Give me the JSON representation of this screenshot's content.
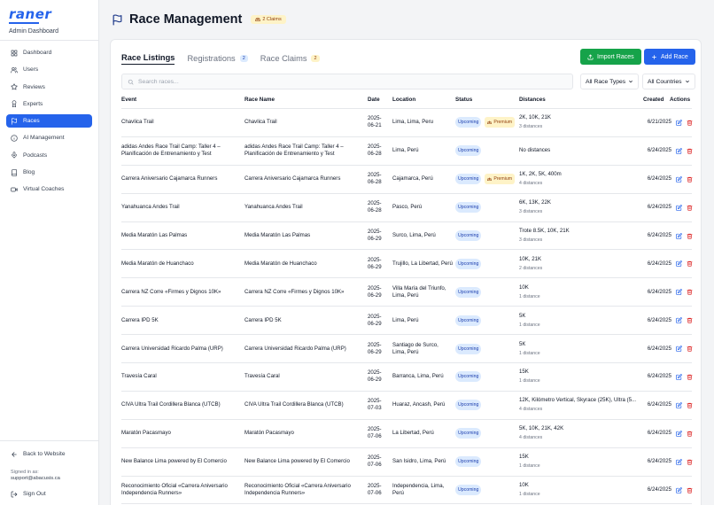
{
  "brand": {
    "logo": "raner",
    "subtitle": "Admin Dashboard"
  },
  "nav": [
    {
      "label": "Dashboard",
      "icon": "grid-icon",
      "active": false
    },
    {
      "label": "Users",
      "icon": "users-icon",
      "active": false
    },
    {
      "label": "Reviews",
      "icon": "star-icon",
      "active": false
    },
    {
      "label": "Experts",
      "icon": "award-icon",
      "active": false
    },
    {
      "label": "Races",
      "icon": "flag-icon",
      "active": true
    },
    {
      "label": "AI Management",
      "icon": "info-icon",
      "active": false
    },
    {
      "label": "Podcasts",
      "icon": "mic-icon",
      "active": false
    },
    {
      "label": "Blog",
      "icon": "book-icon",
      "active": false
    },
    {
      "label": "Virtual Coaches",
      "icon": "video-icon",
      "active": false
    }
  ],
  "footer": {
    "back_label": "Back to Website",
    "signed_in_as": "Signed in as:",
    "email": "support@abacusis.ca",
    "signout_label": "Sign Out"
  },
  "header": {
    "title": "Race Management",
    "claims_badge": "2 Claims"
  },
  "tabs": [
    {
      "label": "Race Listings",
      "badge": ""
    },
    {
      "label": "Registrations",
      "badge": "2"
    },
    {
      "label": "Race Claims",
      "badge": "2"
    }
  ],
  "buttons": {
    "import": "Import Races",
    "add": "Add Race"
  },
  "search": {
    "placeholder": "Search races...",
    "value": ""
  },
  "filters": {
    "race_type": "All Race Types",
    "country": "All Countries"
  },
  "columns": [
    "Event",
    "Race Name",
    "Date",
    "Location",
    "Status",
    "Distances",
    "Created",
    "Actions"
  ],
  "colors": {
    "accent": "#2563eb",
    "import": "#16a34a",
    "delete": "#dc2626"
  },
  "rows": [
    {
      "event": "Chavlica Trail",
      "name": "Chavlica Trail",
      "date": "2025-06-21",
      "location": "Lima, Lima, Peru",
      "status": "Upcoming",
      "premium": "Premium",
      "distances": "2K, 10K, 21K",
      "distance_count": "3 distances",
      "created": "6/21/2025"
    },
    {
      "event": "adidas Andes Race Trail Camp: Taller 4 – Planificación de Entrenamiento y Test",
      "name": "adidas Andes Race Trail Camp: Taller 4 – Planificación de Entrenamiento y Test",
      "date": "2025-06-28",
      "location": "Lima, Perú",
      "status": "Upcoming",
      "premium": "",
      "distances": "No distances",
      "distance_count": "",
      "created": "6/24/2025"
    },
    {
      "event": "Carrera Aniversario Cajamarca Runners",
      "name": "Carrera Aniversario Cajamarca Runners",
      "date": "2025-06-28",
      "location": "Cajamarca, Perú",
      "status": "Upcoming",
      "premium": "Premium",
      "distances": "1K, 2K, 5K, 400m",
      "distance_count": "4 distances",
      "created": "6/24/2025"
    },
    {
      "event": "Yanahuanca Andes Trail",
      "name": "Yanahuanca Andes Trail",
      "date": "2025-06-28",
      "location": "Pasco, Perú",
      "status": "Upcoming",
      "premium": "",
      "distances": "6K, 13K, 22K",
      "distance_count": "3 distances",
      "created": "6/24/2025"
    },
    {
      "event": "Media Maratón Las Palmas",
      "name": "Media Maratón Las Palmas",
      "date": "2025-06-29",
      "location": "Surco, Lima, Perú",
      "status": "Upcoming",
      "premium": "",
      "distances": "Trote 8.5K, 10K, 21K",
      "distance_count": "3 distances",
      "created": "6/24/2025"
    },
    {
      "event": "Media Maratón de Huanchaco",
      "name": "Media Maratón de Huanchaco",
      "date": "2025-06-29",
      "location": "Trujillo, La Libertad, Perú",
      "status": "Upcoming",
      "premium": "",
      "distances": "10K, 21K",
      "distance_count": "2 distances",
      "created": "6/24/2025"
    },
    {
      "event": "Carrera NZ Corre «Firmes y Dignos 10K»",
      "name": "Carrera NZ Corre «Firmes y Dignos 10K»",
      "date": "2025-06-29",
      "location": "Villa María del Triunfo, Lima, Perú",
      "status": "Upcoming",
      "premium": "",
      "distances": "10K",
      "distance_count": "1 distance",
      "created": "6/24/2025"
    },
    {
      "event": "Carrera IPD 5K",
      "name": "Carrera IPD 5K",
      "date": "2025-06-29",
      "location": "Lima, Perú",
      "status": "Upcoming",
      "premium": "",
      "distances": "5K",
      "distance_count": "1 distance",
      "created": "6/24/2025"
    },
    {
      "event": "Carrera Universidad Ricardo Palma (URP)",
      "name": "Carrera Universidad Ricardo Palma (URP)",
      "date": "2025-06-29",
      "location": "Santiago de Surco, Lima, Perú",
      "status": "Upcoming",
      "premium": "",
      "distances": "5K",
      "distance_count": "1 distance",
      "created": "6/24/2025"
    },
    {
      "event": "Travesía Caral",
      "name": "Travesía Caral",
      "date": "2025-06-29",
      "location": "Barranca, Lima, Perú",
      "status": "Upcoming",
      "premium": "",
      "distances": "15K",
      "distance_count": "1 distance",
      "created": "6/24/2025"
    },
    {
      "event": "CIVA Ultra Trail Cordillera Blanca (UTCB)",
      "name": "CIVA Ultra Trail Cordillera Blanca (UTCB)",
      "date": "2025-07-03",
      "location": "Huaraz, Ancash, Perú",
      "status": "Upcoming",
      "premium": "",
      "distances": "12K, Kilómetro Vertical, Skyrace (25K), Ultra (5...",
      "distance_count": "4 distances",
      "created": "6/24/2025"
    },
    {
      "event": "Maratón Pacasmayo",
      "name": "Maratón Pacasmayo",
      "date": "2025-07-06",
      "location": "La Libertad, Perú",
      "status": "Upcoming",
      "premium": "",
      "distances": "5K, 10K, 21K, 42K",
      "distance_count": "4 distances",
      "created": "6/24/2025"
    },
    {
      "event": "New Balance Lima powered by El Comercio",
      "name": "New Balance Lima powered by El Comercio",
      "date": "2025-07-06",
      "location": "San Isidro, Lima, Perú",
      "status": "Upcoming",
      "premium": "",
      "distances": "15K",
      "distance_count": "1 distance",
      "created": "6/24/2025"
    },
    {
      "event": "Reconocimiento Oficial «Carrera Aniversario Independencia Runners»",
      "name": "Reconocimiento Oficial «Carrera Aniversario Independencia Runners»",
      "date": "2025-07-06",
      "location": "Independencia, Lima, Perú",
      "status": "Upcoming",
      "premium": "",
      "distances": "10K",
      "distance_count": "1 distance",
      "created": "6/24/2025"
    }
  ]
}
